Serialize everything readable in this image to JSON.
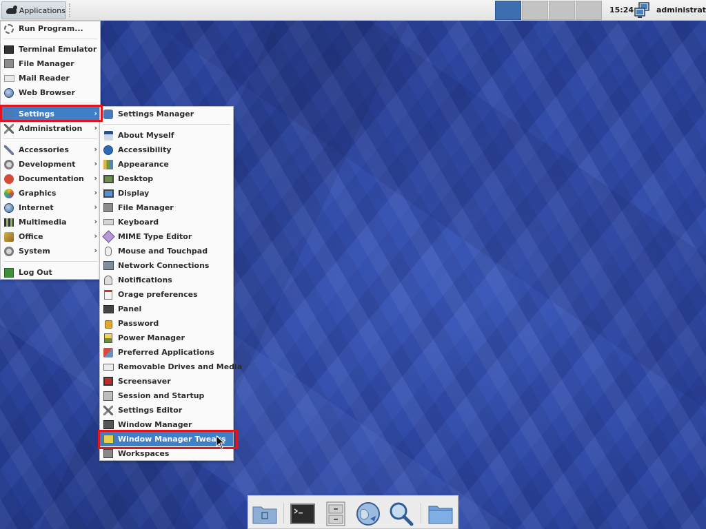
{
  "panel": {
    "applications_label": "Applications",
    "clock": "15:24",
    "user": "administrator",
    "workspace_count": 4,
    "active_workspace": 1
  },
  "apps_menu": {
    "run_program": "Run Program...",
    "terminal": "Terminal Emulator",
    "file_manager": "File Manager",
    "mail_reader": "Mail Reader",
    "web_browser": "Web Browser",
    "settings": "Settings",
    "administration": "Administration",
    "accessories": "Accessories",
    "development": "Development",
    "documentation": "Documentation",
    "graphics": "Graphics",
    "internet": "Internet",
    "multimedia": "Multimedia",
    "office": "Office",
    "system": "System",
    "log_out": "Log Out"
  },
  "settings_menu": {
    "settings_manager": "Settings Manager",
    "about_myself": "About Myself",
    "accessibility": "Accessibility",
    "appearance": "Appearance",
    "desktop": "Desktop",
    "display": "Display",
    "file_manager": "File Manager",
    "keyboard": "Keyboard",
    "mime_type_editor": "MIME Type Editor",
    "mouse_touchpad": "Mouse and Touchpad",
    "network_connections": "Network Connections",
    "notifications": "Notifications",
    "orage_preferences": "Orage preferences",
    "panel": "Panel",
    "password": "Password",
    "power_manager": "Power Manager",
    "preferred_applications": "Preferred Applications",
    "removable_drives": "Removable Drives and Media",
    "screensaver": "Screensaver",
    "session_startup": "Session and Startup",
    "settings_editor": "Settings Editor",
    "window_manager": "Window Manager",
    "window_manager_tweaks": "Window Manager Tweaks",
    "workspaces": "Workspaces"
  },
  "icons": {
    "applications": "xfce-mouse-icon",
    "network": "network-status-icon",
    "dock": [
      "home-folder-icon",
      "terminal-icon",
      "file-cabinet-icon",
      "web-browser-icon",
      "search-icon",
      "folder-icon"
    ]
  },
  "colors": {
    "highlight": "#3e7fc8",
    "annotation_box": "#e0161e",
    "desktop_blue": "#2e47a3"
  }
}
